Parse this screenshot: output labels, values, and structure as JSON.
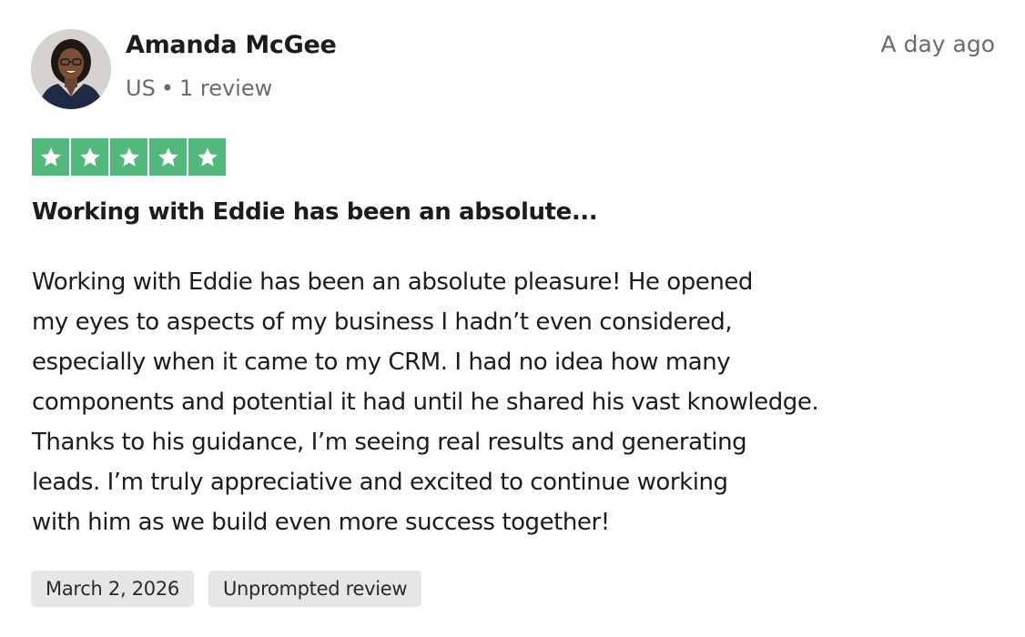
{
  "reviewer": {
    "name": "Amanda McGee",
    "country": "US",
    "separator": "•",
    "review_count": "1 review"
  },
  "review": {
    "age": "A day ago",
    "rating": 5,
    "rating_max": 5,
    "star_color": "#52b87b",
    "title": "Working with Eddie has been an absolute...",
    "body_lines": [
      "Working with Eddie has been an absolute pleasure! He opened",
      "my eyes to aspects of my business I hadn’t even considered,",
      "especially when it came to my CRM. I had no idea how many",
      "components and potential it had until he shared his vast knowledge.",
      "Thanks to his guidance, I’m seeing real results and generating",
      "leads. I’m truly appreciative and excited to continue working",
      "with him as we build even more success together!"
    ],
    "tags": [
      {
        "label": "March 2, 2026"
      },
      {
        "label": "Unprompted review"
      }
    ]
  }
}
